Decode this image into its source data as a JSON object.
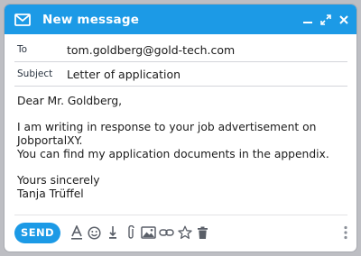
{
  "window": {
    "title": "New message"
  },
  "fields": {
    "to": {
      "label": "To",
      "value": "tom.goldberg@gold-tech.com"
    },
    "subject": {
      "label": "Subject",
      "value": "Letter of application"
    }
  },
  "body": {
    "greeting": "Dear Mr. Goldberg,",
    "line1": "I am writing in response to your job advertisement on",
    "line2": "JobportalXY.",
    "line3": "You can find my application documents in the appendix.",
    "closing": "Yours sincerely",
    "signature": "Tanja Trüffel"
  },
  "toolbar": {
    "send_label": "SEND",
    "icons": [
      "text-format-icon",
      "emoji-icon",
      "attach-file-icon",
      "attachment-clip-icon",
      "image-icon",
      "link-icon",
      "star-icon",
      "trash-icon",
      "more-options-icon"
    ]
  },
  "colors": {
    "accent": "#1c9ae6",
    "icon": "#5a5f68"
  }
}
